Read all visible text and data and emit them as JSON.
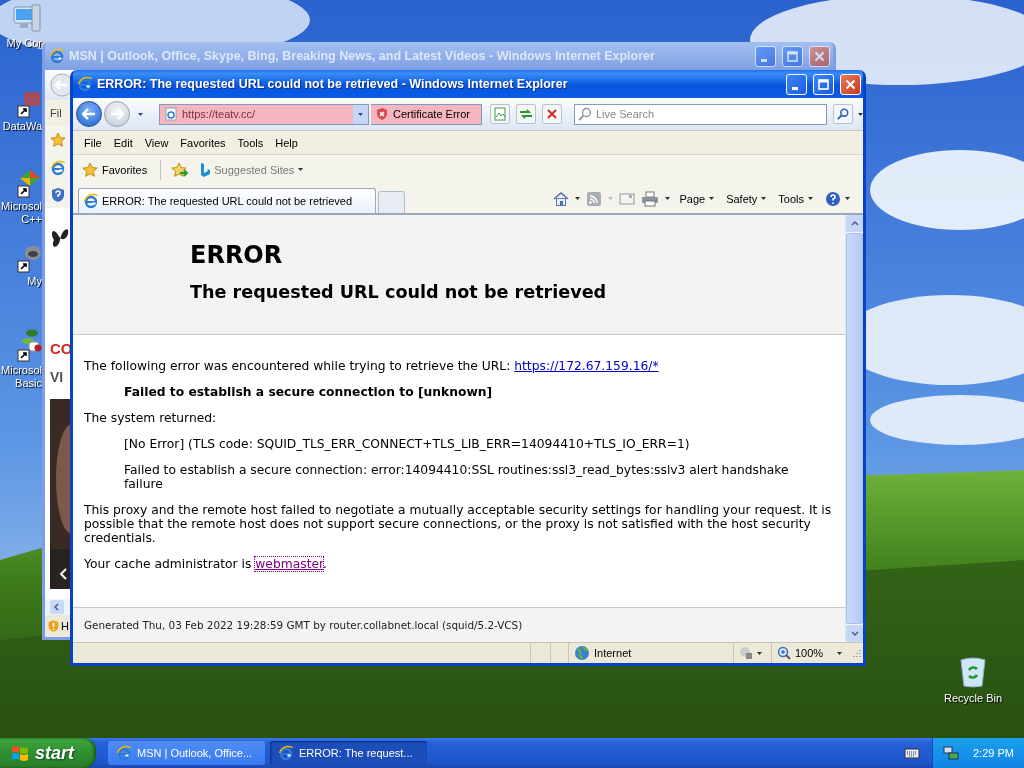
{
  "desktop": {
    "icons": [
      {
        "kind": "computer",
        "label": "My Cor"
      },
      {
        "kind": "document",
        "label": "DataWa"
      },
      {
        "kind": "chart",
        "label": "Microsol\nC++"
      },
      {
        "kind": "tool",
        "label": "My"
      },
      {
        "kind": "plant",
        "label": "Microsol\nBasic"
      }
    ],
    "recycle_bin": {
      "label": "Recycle Bin"
    }
  },
  "background_window": {
    "title": "MSN | Outlook, Office, Skype, Bing, Breaking News, and Latest Videos - Windows Internet Explorer",
    "menu_item": "Fil",
    "headline": "CO",
    "subhead": "VI",
    "status": "H"
  },
  "window": {
    "title": "ERROR: The requested URL could not be retrieved - Windows Internet Explorer",
    "address": "https://teatv.cc/",
    "certificate": "Certificate Error",
    "search_placeholder": "Live Search",
    "menu": [
      "File",
      "Edit",
      "View",
      "Favorites",
      "Tools",
      "Help"
    ],
    "favorites": "Favorites",
    "suggested_sites": "Suggested Sites",
    "tabs": [
      {
        "label": "ERROR: The requested URL could not be retrieved",
        "selected": true
      }
    ],
    "commands": [
      "Page",
      "Safety",
      "Tools"
    ],
    "page": {
      "heading": "ERROR",
      "subheading": "The requested URL could not be retrieved",
      "blocks": [
        {
          "kind": "text",
          "text": "The following error was encountered while trying to retrieve the URL: ",
          "link": {
            "text": "https://172.67.159.16/*",
            "visited": false
          }
        },
        {
          "kind": "bold",
          "text": "Failed to establish a secure connection to [unknown]"
        },
        {
          "kind": "text",
          "text": "The system returned:"
        },
        {
          "kind": "indent",
          "text": "[No Error] (TLS code: SQUID_TLS_ERR_CONNECT+TLS_LIB_ERR=14094410+TLS_IO_ERR=1)"
        },
        {
          "kind": "indent",
          "text": "Failed to establish a secure connection: error:14094410:SSL routines:ssl3_read_bytes:sslv3 alert handshake failure"
        },
        {
          "kind": "text",
          "text": "This proxy and the remote host failed to negotiate a mutually acceptable security settings for handling your request. It is possible that the remote host does not support secure connections, or the proxy is not satisfied with the host security credentials."
        },
        {
          "kind": "text",
          "text": "Your cache administrator is ",
          "link": {
            "text": "webmaster",
            "visited": true
          },
          "after": "."
        }
      ],
      "footer": "Generated Thu, 03 Feb 2022 19:28:59 GMT by router.collabnet.local (squid/5.2-VCS)"
    },
    "status_bar": {
      "zone": "Internet",
      "zoom": "100%"
    }
  },
  "taskbar": {
    "start": "start",
    "tasks": [
      {
        "label": "MSN | Outlook, Office...",
        "selected": false
      },
      {
        "label": "ERROR: The request...",
        "selected": true
      }
    ],
    "clock": "2:29 PM"
  }
}
